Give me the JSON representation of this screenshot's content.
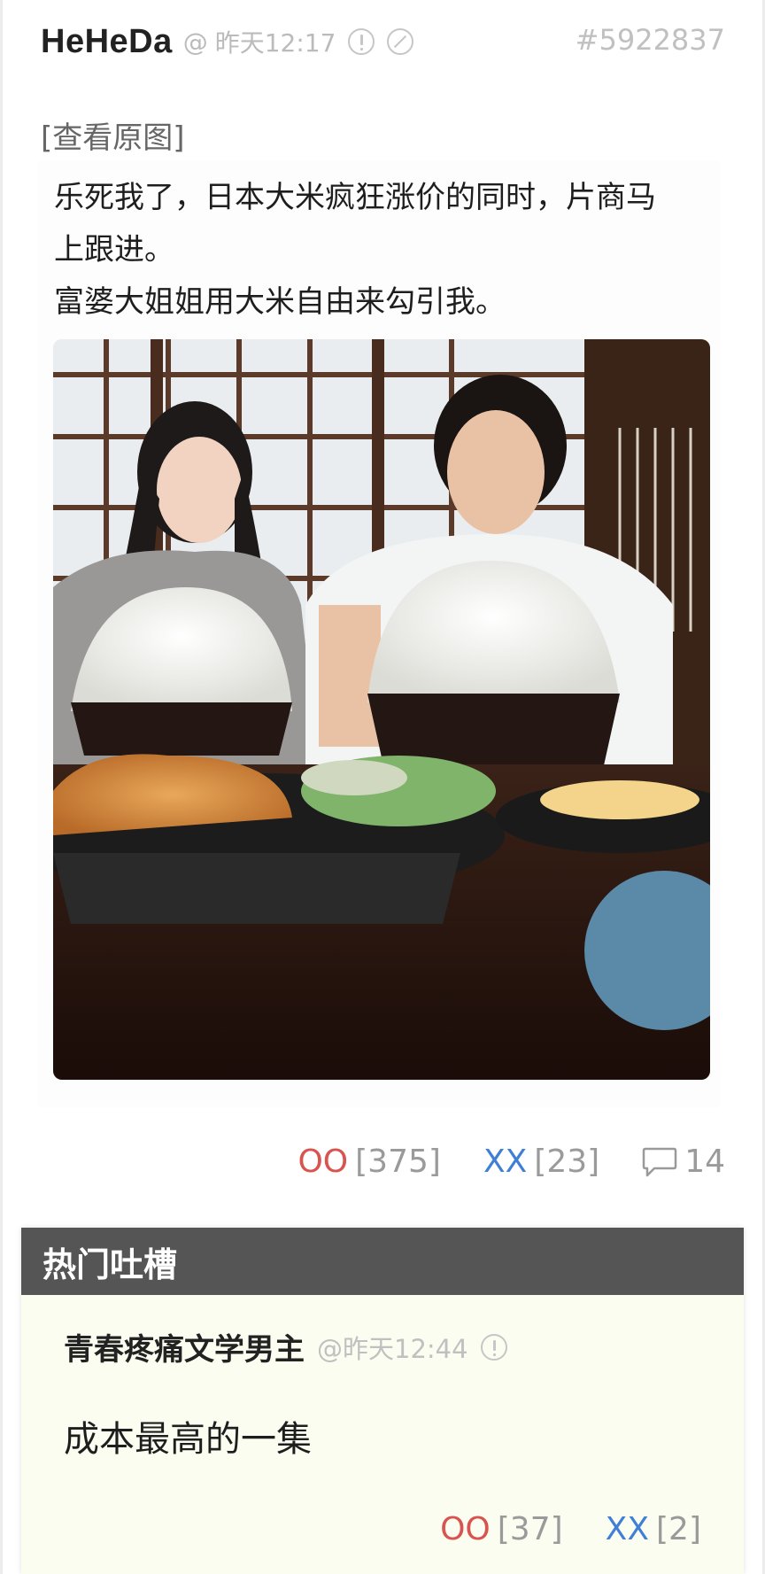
{
  "post": {
    "author": "HeHeDa",
    "at": "@",
    "time": "昨天12:17",
    "id": "#5922837",
    "view_original": "[查看原图]",
    "text_lines": [
      "乐死我了，日本大米疯狂涨价的同时，片商马",
      "上跟进。",
      "富婆大姐姐用大米自由来勾引我。"
    ],
    "votes": {
      "oo_label": "OO",
      "oo_count": "[375]",
      "xx_label": "XX",
      "xx_count": "[23]",
      "comment_count": "14"
    }
  },
  "hot_comments": {
    "title": "热门吐槽",
    "items": [
      {
        "author": "青春疼痛文学男主",
        "time": "@昨天12:44",
        "text": "成本最高的一集",
        "oo_label": "OO",
        "oo_count": "[37]",
        "xx_label": "XX",
        "xx_count": "[2]"
      }
    ]
  },
  "colors": {
    "oo": "#d9534f",
    "xx": "#3f7fd6",
    "hot_header_bg": "#555555",
    "hot_bg": "#fcfdf1"
  },
  "icons": [
    "info-icon",
    "block-icon",
    "comment-icon"
  ]
}
